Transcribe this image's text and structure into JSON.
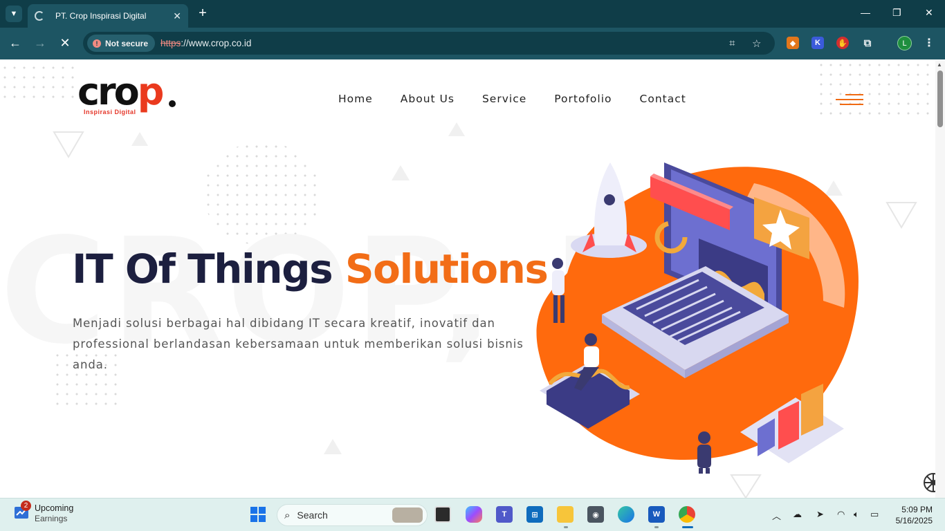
{
  "browser": {
    "tab_title": "PT. Crop Inspirasi Digital",
    "tab_close": "✕",
    "new_tab": "+",
    "security_label": "Not secure",
    "url_scheme": "https",
    "url_rest": "://www.crop.co.id"
  },
  "site": {
    "logo_text_main": "cro",
    "logo_text_accent": "p",
    "logo_tagline": "Inspirasi Digital",
    "nav": [
      "Home",
      "About Us",
      "Service",
      "Portofolio",
      "Contact"
    ],
    "watermark": "CROP, PT",
    "hero": {
      "title_dark": "IT Of Things",
      "title_accent": "Solutions",
      "description": "Menjadi solusi berbagai hal dibidang IT secara kreatif, inovatif dan professional berlandasan kebersamaan untuk memberikan solusi bisnis anda."
    }
  },
  "taskbar": {
    "weather_badge": "2",
    "weather_line1": "Upcoming",
    "weather_line2": "Earnings",
    "search_label": "Search",
    "profile_initial": "L",
    "time": "5:09 PM",
    "date": "5/16/2025"
  },
  "colors": {
    "brand_orange": "#f26d17",
    "heading_navy": "#1c1f3f",
    "chrome_teal": "#1d5563"
  }
}
